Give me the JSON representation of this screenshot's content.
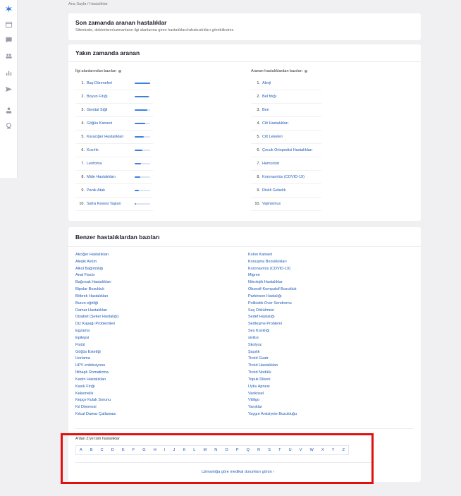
{
  "breadcrumb": "Ana Sayfa / Hastalıklar",
  "intro": {
    "title": "Son zamanda aranan hastalıklar",
    "subtitle": "Sitemizde, doktorların/uzmanların ilgi alanlarına giren hastalıkları/rahatsızlıkları görebilirsiniz."
  },
  "recent": {
    "title": "Yakın zamanda aranan",
    "left_header": "İlgi alanlarından bazıları",
    "right_header": "Aranan hastalıklardan bazıları",
    "left_items": [
      {
        "rank": "1.",
        "name": "Baş Dönmeleri",
        "level": 1.0
      },
      {
        "rank": "2.",
        "name": "Boyun Fıtığı",
        "level": 0.9
      },
      {
        "rank": "3.",
        "name": "Genital Siğil",
        "level": 0.8
      },
      {
        "rank": "4.",
        "name": "Göğüs Kanseri",
        "level": 0.7
      },
      {
        "rank": "5.",
        "name": "Karaciğer Hastalıkları",
        "level": 0.6
      },
      {
        "rank": "6.",
        "name": "Kısırlık",
        "level": 0.5
      },
      {
        "rank": "7.",
        "name": "Lenfoma",
        "level": 0.42
      },
      {
        "rank": "8.",
        "name": "Mide Hastalıkları",
        "level": 0.35
      },
      {
        "rank": "9.",
        "name": "Panik Atak",
        "level": 0.25
      },
      {
        "rank": "10.",
        "name": "Safra Kesesi Taşları",
        "level": 0.1
      }
    ],
    "right_items": [
      {
        "rank": "1.",
        "name": "Alerji"
      },
      {
        "rank": "2.",
        "name": "Bel fıtığı"
      },
      {
        "rank": "3.",
        "name": "Ben"
      },
      {
        "rank": "4.",
        "name": "Cilt Hastalıkları"
      },
      {
        "rank": "5.",
        "name": "Cilt Lekeleri"
      },
      {
        "rank": "6.",
        "name": "Çocuk Ortopedisi Hastalıkları"
      },
      {
        "rank": "7.",
        "name": "Hemoroid"
      },
      {
        "rank": "8.",
        "name": "Koronavirüs (COVID-19)"
      },
      {
        "rank": "9.",
        "name": "Riskli Gebelik"
      },
      {
        "rank": "10.",
        "name": "Vajinismus"
      }
    ]
  },
  "similar": {
    "title": "Benzer hastalıklardan bazıları",
    "left_links": [
      "Akciğer Hastalıkları",
      "Alerjik Astım",
      "Alkol Bağımlılığı",
      "Anal Fissür",
      "Bağırsak Hastalıkları",
      "Bipolar Bozukluk",
      "Böbrek Hastalıkları",
      "Burun eğriliği",
      "Damar Hastalıkları",
      "Diyabet (Şeker Hastalığı)",
      "Diz Kapağı Problemleri",
      "Egzama",
      "Epilepsi",
      "Fistül",
      "Göğüs Estetiği",
      "Horlama",
      "HPV enfeksiyonu",
      "İltihaplı Romatizma",
      "Kadın Hastalıkları",
      "Kasık Fıtığı",
      "Kekemelik",
      "Kepçe Kulak Sorunu",
      "Kıl Dönmesi",
      "Kılcal Damar Çatlaması"
    ],
    "right_links": [
      "Kolon Kanseri",
      "Konuşma Bozuklukları",
      "Koronavirüs (COVID-19)",
      "Migren",
      "Nörolojik Hastalıklar",
      "Obsesif-Kompulsif Bozukluk",
      "Parkinson Hastalığı",
      "Polikistik Over Sendromu",
      "Saç Dökülmesi",
      "Sedef Hastalığı",
      "Sertleşme Problemi",
      "Ses Kısıklığı",
      "sivilce",
      "Skolyoz",
      "Şaşılık",
      "Tiroid Guatr",
      "Tiroid Hastalıkları",
      "Tiroid Nodülü",
      "Topuk Dikeni",
      "Uyku Apnesi",
      "Varikosel",
      "Vitiligo",
      "Yanıklar",
      "Yaygın Anksiyete Bozukluğu"
    ]
  },
  "az": {
    "title": "A'dan Z'ye tüm hastalıklar",
    "letters": [
      "A",
      "B",
      "C",
      "D",
      "E",
      "F",
      "G",
      "H",
      "I",
      "J",
      "K",
      "L",
      "M",
      "N",
      "O",
      "P",
      "Q",
      "R",
      "S",
      "T",
      "U",
      "V",
      "W",
      "X",
      "Y",
      "Z"
    ],
    "specialty_link": "Uzmanlığa göre medikal durumları görün ›"
  },
  "colors": {
    "accent": "#1f5ab5",
    "bar": "#3d7fe0",
    "highlight": "#e01010"
  },
  "sidebar_icons": [
    "star-logo-icon",
    "calendar-icon",
    "chat-icon",
    "people-icon",
    "bar-chart-icon",
    "send-icon",
    "doctor-icon",
    "award-icon"
  ]
}
